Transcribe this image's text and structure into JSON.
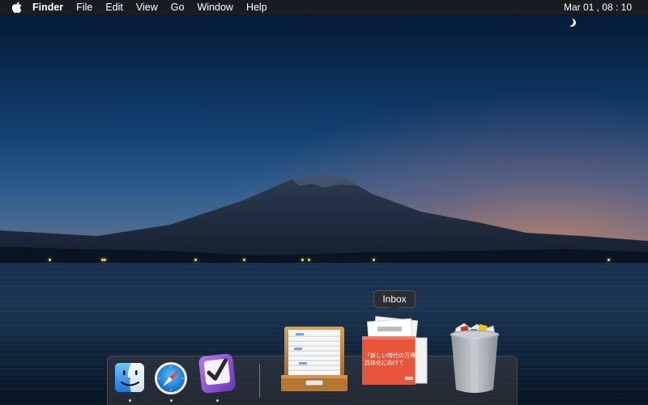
{
  "menubar": {
    "apple_icon": "apple-logo-icon",
    "app_name": "Finder",
    "items": [
      "File",
      "Edit",
      "View",
      "Go",
      "Window",
      "Help"
    ],
    "clock": "Mar 01 , 08 : 10"
  },
  "dock": {
    "items": [
      {
        "name": "Finder",
        "icon": "finder-icon",
        "running": true
      },
      {
        "name": "Safari",
        "icon": "safari-compass-icon",
        "running": true
      },
      {
        "name": "OmniFocus",
        "icon": "checkmark-app-icon",
        "running": true
      },
      {
        "name": "Documents",
        "icon": "file-drawer-icon",
        "running": false
      },
      {
        "name": "Inbox",
        "icon": "inbox-stack-icon",
        "running": false
      },
      {
        "name": "Trash",
        "icon": "trash-full-icon",
        "running": false
      }
    ],
    "tooltip": "Inbox",
    "inbox_doc_text": "「新しい時代の万博」の\n具体化に向けて"
  },
  "colors": {
    "menubar_bg": "#1c1c1e",
    "accent_orange": "#e8553a",
    "finder_blue": "#3b8ee8",
    "omnifocus_purple": "#8e4fcf"
  }
}
